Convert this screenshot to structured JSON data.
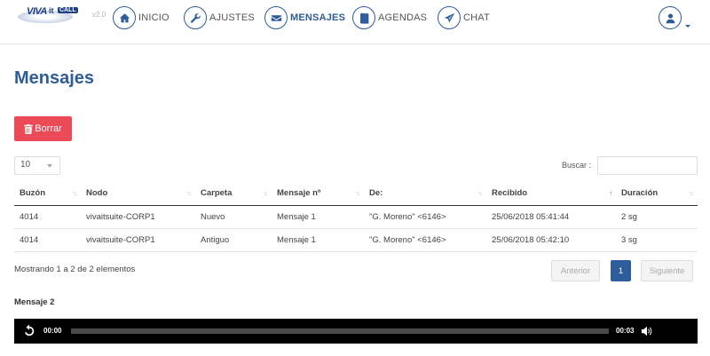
{
  "logo": {
    "brand": "VIVA",
    "it": "it",
    "call": "CALL",
    "version": "v2.0"
  },
  "nav": {
    "items": [
      {
        "label": "INICIO",
        "icon": "home-icon"
      },
      {
        "label": "AJUSTES",
        "icon": "wrench-icon"
      },
      {
        "label": "MENSAJES",
        "icon": "envelope-icon"
      },
      {
        "label": "AGENDAS",
        "icon": "book-icon"
      },
      {
        "label": "CHAT",
        "icon": "send-icon"
      }
    ],
    "active": "MENSAJES",
    "user_icon": "user-icon"
  },
  "page": {
    "title": "Mensajes"
  },
  "toolbar": {
    "delete_label": "Borrar",
    "delete_icon": "trash-icon"
  },
  "controls": {
    "page_size": "10",
    "search_label": "Buscar :",
    "search_value": ""
  },
  "table": {
    "headers": [
      "Buzón",
      "Nodo",
      "Carpeta",
      "Mensaje nº",
      "De:",
      "Recibido",
      "Duración"
    ],
    "rows": [
      [
        "4014",
        "vivaitsuite-CORP1",
        "Nuevo",
        "Mensaje 1",
        "\"G. Moreno\" <6146>",
        "25/06/2018 05:41:44",
        "2 sg"
      ],
      [
        "4014",
        "vivaitsuite-CORP1",
        "Antiguo",
        "Mensaje 1",
        "\"G. Moreno\" <6146>",
        "25/06/2018 05:42:10",
        "3 sg"
      ]
    ]
  },
  "pagination": {
    "info": "Mostrando 1 a 2 de 2 elementos",
    "prev": "Anterior",
    "current": "1",
    "next": "Siguiente"
  },
  "player": {
    "title": "Mensaje 2",
    "current_time": "00:00",
    "duration": "00:03",
    "progress": 0
  },
  "colors": {
    "accent": "#2f5c9a",
    "danger": "#ec4a56",
    "player_bg": "#000000"
  }
}
